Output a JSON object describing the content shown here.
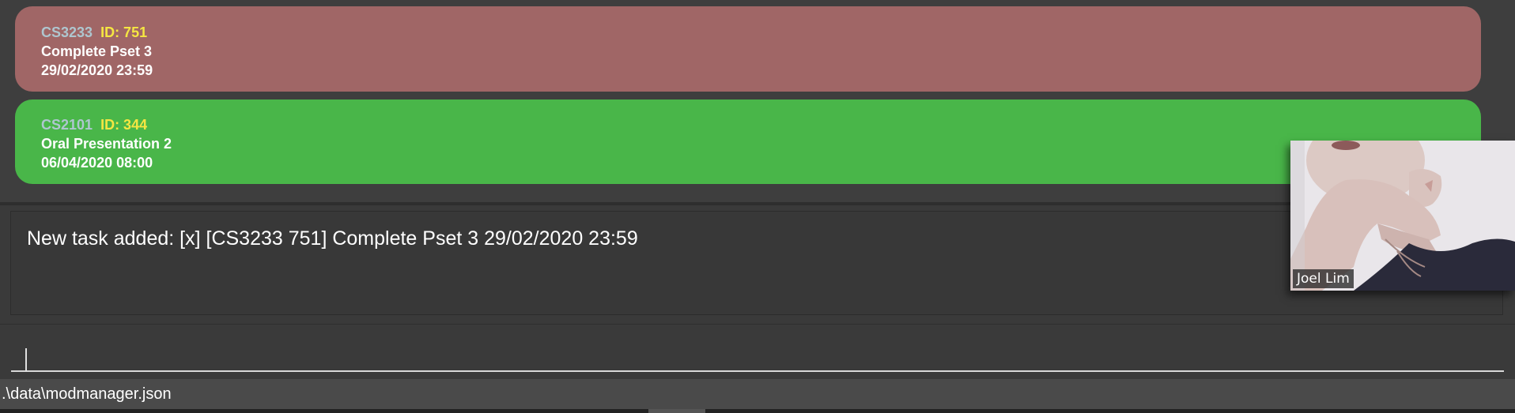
{
  "tasks": [
    {
      "module_code": "CS3233",
      "id_text": "ID: 751",
      "description": "Complete Pset 3",
      "datetime": "29/02/2020 23:59",
      "color": "#a06666"
    },
    {
      "module_code": "CS2101",
      "id_text": "ID: 344",
      "description": "Oral Presentation 2",
      "datetime": "06/04/2020 08:00",
      "color": "#49b649"
    }
  ],
  "result": {
    "message": "New task added: [x] [CS3233 751] Complete Pset 3 29/02/2020 23:59"
  },
  "command": {
    "value": ""
  },
  "status": {
    "file_path": ".\\data\\modmanager.json"
  },
  "video": {
    "participant_name": "Joel Lim"
  }
}
